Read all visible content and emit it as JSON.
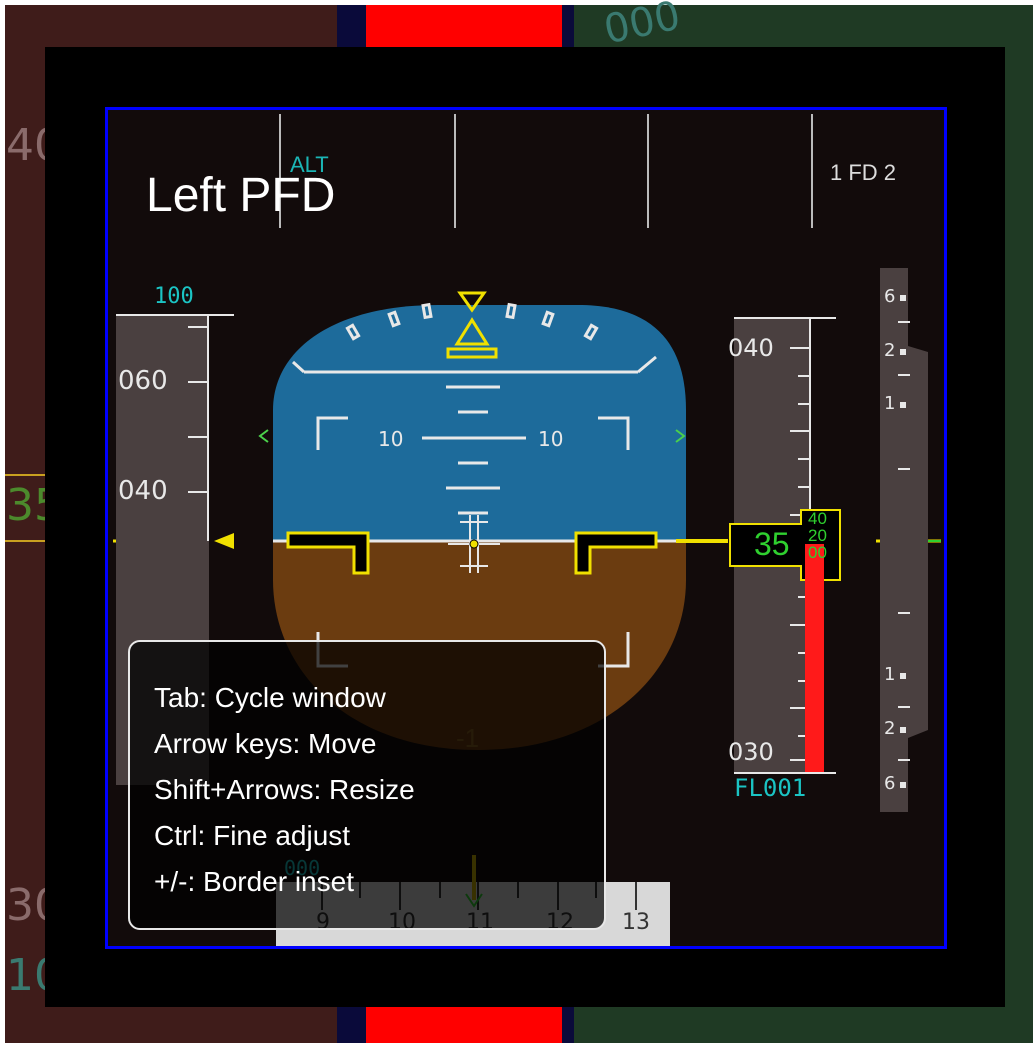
{
  "window": {
    "title": "Left PFD"
  },
  "background": {
    "left_values": [
      "40",
      "35",
      "30",
      "10"
    ],
    "right_values": [
      "000"
    ]
  },
  "pfd": {
    "fd_label": "1 FD 2",
    "fma_alt": "ALT",
    "speed_tape": {
      "target": "100",
      "ticks": [
        "060",
        "040"
      ]
    },
    "attitude": {
      "pitch_left": "10",
      "pitch_right": "10",
      "below_label": "-1"
    },
    "altitude_tape": {
      "ticks": [
        "040",
        "030"
      ],
      "current_major": "35",
      "current_minor": [
        "40",
        "20",
        "00"
      ],
      "flight_level": "FL001"
    },
    "vsi": {
      "labels_up": [
        "6",
        "2",
        "1"
      ],
      "labels_down": [
        "1",
        "2",
        "6"
      ]
    },
    "heading": {
      "label": "000",
      "ticks": [
        "9",
        "10",
        "11",
        "12",
        "13"
      ]
    }
  },
  "help_overlay": {
    "lines": [
      "Tab: Cycle window",
      "Arrow keys: Move",
      "Shift+Arrows: Resize",
      "Ctrl: Fine adjust",
      "+/-: Border inset"
    ]
  },
  "colors": {
    "sky": "#1d6b9b",
    "ground": "#6b3c10",
    "symbol_yellow": "#f0e000",
    "scale_cyan": "#1bc4c4",
    "alt_green": "#2fd02f",
    "trend_red": "#ff1a1a",
    "border_blue": "#0000ff"
  }
}
